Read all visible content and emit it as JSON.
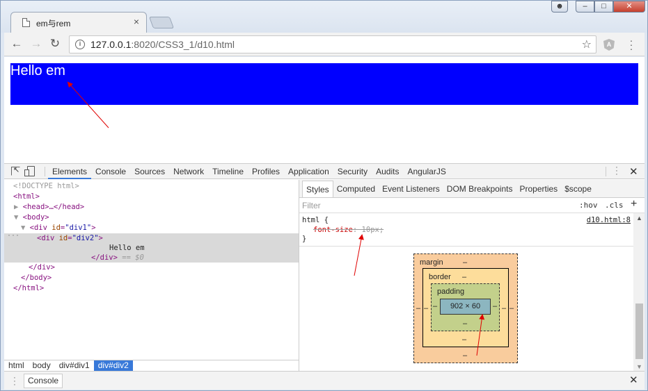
{
  "browser": {
    "tab_title": "em与rem",
    "tab_close": "×",
    "url_host": "127.0.0.1",
    "url_path": ":8020/CSS3_1/d10.html",
    "ext_badge": "A"
  },
  "page": {
    "div2_text": "Hello em",
    "div1_color": "#0000ff"
  },
  "devtools": {
    "tabs": [
      "Elements",
      "Console",
      "Sources",
      "Network",
      "Timeline",
      "Profiles",
      "Application",
      "Security",
      "Audits",
      "AngularJS"
    ],
    "active_tab": "Elements",
    "dom": {
      "doctype": "<!DOCTYPE html>",
      "html_open": "<html>",
      "head": "<head>…</head>",
      "body_open": "<body>",
      "div1_tag": "<div ",
      "div1_attr": "id",
      "div1_val": "\"div1\"",
      "div2_tag": "<div ",
      "div2_attr": "id",
      "div2_val": "\"div2\"",
      "div2_text": "Hello em",
      "div2_close": "</div>",
      "div2_eq": " == $0",
      "div1_close": "</div>",
      "body_close": "</body>",
      "html_close": "</html>"
    },
    "breadcrumbs": [
      "html",
      "body",
      "div#div1",
      "div#div2"
    ],
    "style_tabs": [
      "Styles",
      "Computed",
      "Event Listeners",
      "DOM Breakpoints",
      "Properties",
      "$scope"
    ],
    "filter_placeholder": "Filter",
    "hov": ":hov",
    "cls": ".cls",
    "rule": {
      "selector": "html {",
      "source": "d10.html:8",
      "prop_name": "font-size",
      "prop_value": ": 10px;",
      "close": "}"
    },
    "box_model": {
      "margin_label": "margin",
      "border_label": "border",
      "padding_label": "padding",
      "content_size": "902 × 60",
      "dash": "–"
    },
    "drawer_tab": "Console"
  }
}
